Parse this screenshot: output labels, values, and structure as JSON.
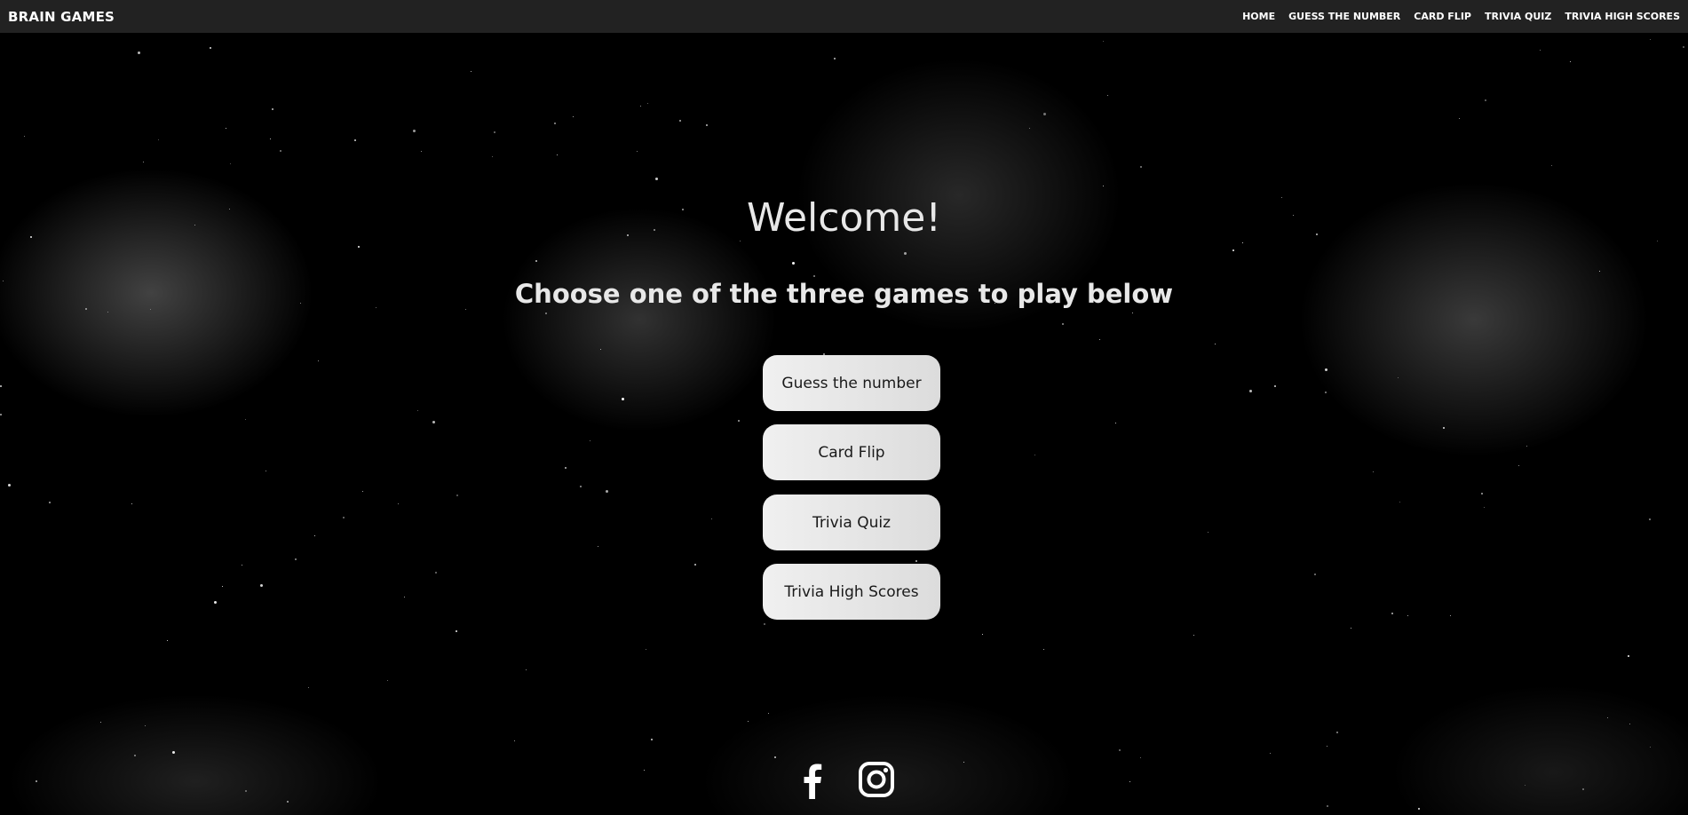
{
  "navbar": {
    "brand": "BRAIN GAMES",
    "links": [
      {
        "label": "HOME"
      },
      {
        "label": "GUESS THE NUMBER"
      },
      {
        "label": "CARD FLIP"
      },
      {
        "label": "TRIVIA QUIZ"
      },
      {
        "label": "TRIVIA HIGH SCORES"
      }
    ]
  },
  "main": {
    "title": "Welcome!",
    "subtitle": "Choose one of the three games to play below",
    "buttons": [
      {
        "label": "Guess the number"
      },
      {
        "label": "Card Flip"
      },
      {
        "label": "Trivia Quiz"
      },
      {
        "label": "Trivia High Scores"
      }
    ]
  },
  "footer": {
    "icons": [
      "facebook-icon",
      "instagram-icon"
    ]
  },
  "colors": {
    "navbar_bg": "#222222",
    "button_bg": "#e6e6e6",
    "text": "#e8e8e8"
  }
}
